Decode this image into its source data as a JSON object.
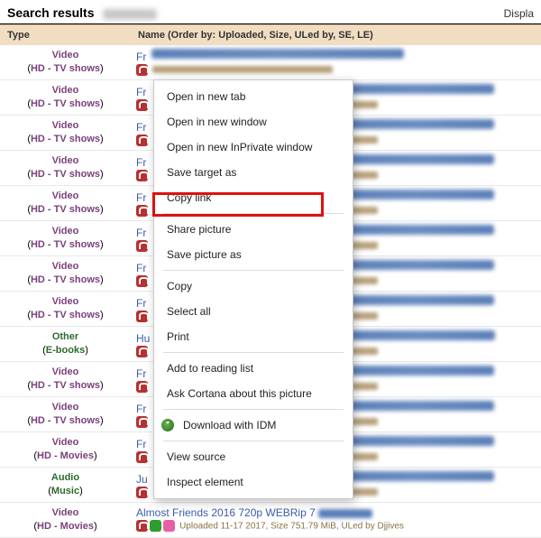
{
  "header": {
    "title": "Search results",
    "right": "Displa"
  },
  "columns": {
    "type": "Type",
    "name": "Name (Order by: Uploaded, Size, ULed by, SE, LE)"
  },
  "types": {
    "video": "Video",
    "hd_tv": "HD - TV shows",
    "hd_movies": "HD - Movies",
    "other": "Other",
    "ebooks": "E-books",
    "audio": "Audio",
    "music": "Music"
  },
  "type_wrap": {
    "open": "(",
    "close": ")"
  },
  "row_stub": {
    "fr": "Fr",
    "hu": "Hu",
    "ju": "Ju"
  },
  "last_row": {
    "title_prefix": "Almost Friends 2016 720p WEBRip 7",
    "meta": "Uploaded 11-17 2017, Size 751.79 MiB, ULed by Djjives"
  },
  "context_menu": {
    "open_tab": "Open in new tab",
    "open_window": "Open in new window",
    "open_inprivate": "Open in new InPrivate window",
    "save_target": "Save target as",
    "copy_link": "Copy link",
    "share_picture": "Share picture",
    "save_picture": "Save picture as",
    "copy": "Copy",
    "select_all": "Select all",
    "print": "Print",
    "reading_list": "Add to reading list",
    "ask_cortana": "Ask Cortana about this picture",
    "download_idm": "Download with IDM",
    "view_source": "View source",
    "inspect": "Inspect element"
  }
}
